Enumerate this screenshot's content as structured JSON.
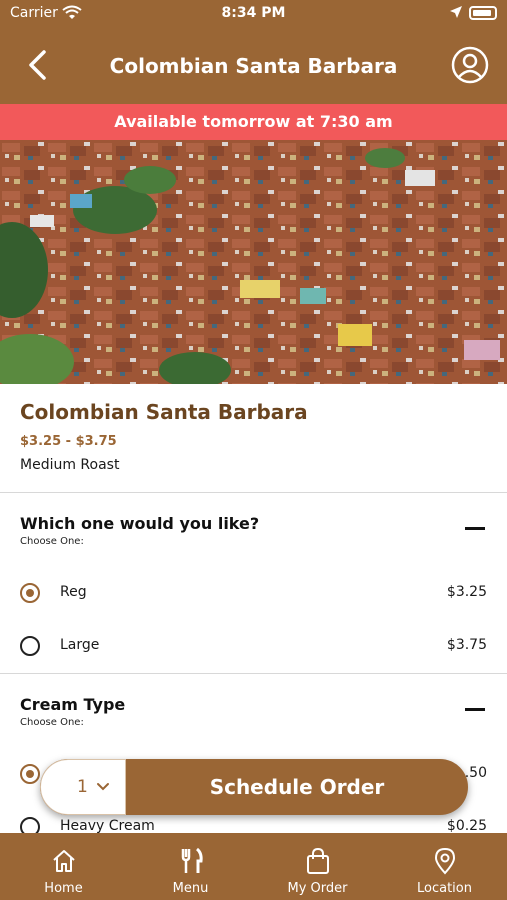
{
  "status_bar": {
    "carrier": "Carrier",
    "time": "8:34 PM"
  },
  "nav": {
    "title": "Colombian Santa Barbara",
    "back_icon": "chevron-left-icon",
    "profile_icon": "user-circle-icon"
  },
  "banner": {
    "text": "Available tomorrow at 7:30 am"
  },
  "product": {
    "name": "Colombian Santa Barbara",
    "price_range": "$3.25 - $3.75",
    "roast": "Medium Roast"
  },
  "sections": [
    {
      "heading": "Which one would you like?",
      "subheading": "Choose One:",
      "options": [
        {
          "label": "Reg",
          "price": "$3.25",
          "selected": true
        },
        {
          "label": "Large",
          "price": "$3.75",
          "selected": false
        }
      ]
    },
    {
      "heading": "Cream Type",
      "subheading": "Choose One:",
      "options": [
        {
          "label": "",
          "price": ".50",
          "selected": true
        },
        {
          "label": "Heavy Cream",
          "price": "$0.25",
          "selected": false
        }
      ]
    }
  ],
  "order": {
    "quantity": "1",
    "button_label": "Schedule Order"
  },
  "tabs": [
    {
      "label": "Home",
      "icon": "home-icon"
    },
    {
      "label": "Menu",
      "icon": "utensils-icon"
    },
    {
      "label": "My Order",
      "icon": "shopping-bag-icon"
    },
    {
      "label": "Location",
      "icon": "map-pin-icon"
    }
  ],
  "colors": {
    "brand": "#9a6635",
    "banner": "#f2595a",
    "title_text": "#6b4520"
  }
}
